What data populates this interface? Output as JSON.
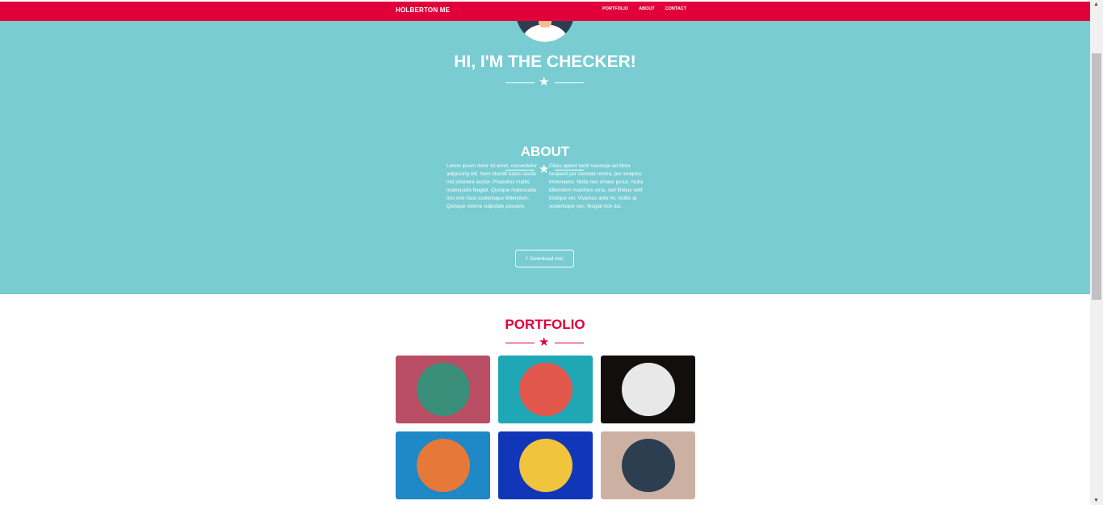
{
  "nav": {
    "brand": "HOLBERTON ME",
    "links": [
      "PORTFOLIO",
      "ABOUT",
      "CONTACT"
    ]
  },
  "hero": {
    "title": "HI, I'M THE CHECKER!"
  },
  "about": {
    "title": "ABOUT",
    "col1": "Lorem ipsum dolor sit amet, consectetur adipiscing elit. Nam blandit turpis iaculis nisl pharetra auctor. Phasellus mattis malesuada feugiat. Quisque malesuada orci non risus scelerisque bibendum. Quisque viverra vulputate posuere.",
    "col2": "Class aptent taciti sociosqu ad litora torquent per conubia nostra, per inceptos himenaeos. Nulla non ornare purus. Nulla bibendum maximus urna, sed finibus velit tristique vel. Vivamus ante mi, mollis at scelerisque nec, feugiat non dui.",
    "download_label": "Download me!"
  },
  "portfolio": {
    "title": "PORTFOLIO",
    "items": [
      {
        "icon": "cabin-icon",
        "bg": "#b94e64",
        "circle": "#3a8f7a"
      },
      {
        "icon": "cake-icon",
        "bg": "#1fa7b5",
        "circle": "#e2574c"
      },
      {
        "icon": "circus-tent-icon",
        "bg": "#130e0e",
        "circle": "#e8e8e8"
      },
      {
        "icon": "game-controller-icon",
        "bg": "#1f88c7",
        "circle": "#e6793a"
      },
      {
        "icon": "safe-icon",
        "bg": "#1136b8",
        "circle": "#f0c43c"
      },
      {
        "icon": "submarine-icon",
        "bg": "#ccb1a3",
        "circle": "#2c3e50"
      }
    ]
  },
  "colors": {
    "accent": "#e2003b",
    "hero": "#78ccd2"
  }
}
